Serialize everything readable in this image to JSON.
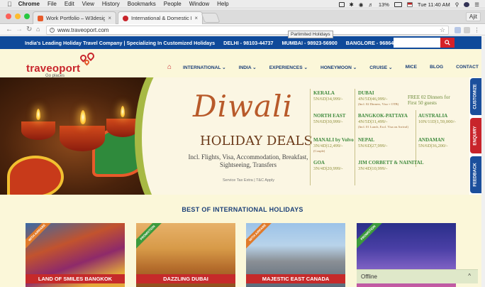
{
  "macos": {
    "app": "Chrome",
    "menus": [
      "File",
      "Edit",
      "View",
      "History",
      "Bookmarks",
      "People",
      "Window",
      "Help"
    ],
    "battery": "13%",
    "clock": "Tue 11:40 AM"
  },
  "browser": {
    "tabs": [
      {
        "title": "Work Portfolio – W3design.in",
        "active": false
      },
      {
        "title": "International & Domestic Holiday",
        "active": true
      }
    ],
    "profile": "Ajit",
    "url": "www.traveoport.com",
    "tooltip": "Parlimited Holidays"
  },
  "topbar": {
    "tagline": "India's Leading Holiday Travel Company | Specializing In Customized Holidays",
    "phones": [
      "DELHI - 98103-44737",
      "MUMBAI - 98923-56900",
      "BANGLORE - 96864-58583"
    ],
    "search_placeholder": ""
  },
  "brand": {
    "logo_text": "traveoport",
    "logo_sub": "Go places",
    "accent": "#c8242b",
    "navy": "#0f4a9a"
  },
  "nav": {
    "items": [
      "INTERNATIONAL ⌄",
      "INDIA ⌄",
      "EXPERIENCES ⌄",
      "HONEYMOON ⌄",
      "CRUISE ⌄",
      "MICE",
      "BLOG",
      "CONTACT"
    ]
  },
  "banner": {
    "headline": "Diwali",
    "subheadline": "HOLIDAY DEALS",
    "includes": "Incl. Flights, Visa, Accommodation, Breakfast, Sightseeing, Transfers",
    "service_tax": "Service Tax Extra | T&C Apply",
    "free_offer": "FREE 02 Dinners for First 50 guests",
    "deals_col1": [
      {
        "place": "KERALA",
        "price": "5N/6D|34,999/-",
        "note": ""
      },
      {
        "place": "NORTH EAST",
        "price": "5N/6D|30,999/-",
        "note": ""
      },
      {
        "place": "MANALI by Volvo",
        "price": "3N/4D|12,499/-",
        "note": "(Couple)"
      },
      {
        "place": "GOA",
        "price": "3N/4D|20,999/-",
        "note": ""
      }
    ],
    "deals_col2": [
      {
        "place": "DUBAI",
        "price": "4N/5D|46,999/-",
        "note": "(Incl. 02 Dinners, Visa + OTB)"
      },
      {
        "place": "BANGKOK-PATTAYA",
        "price": "4N/5D|31,499/-",
        "note": "(Incl. 01 Lunch, Excl. Visa on Arrival)"
      },
      {
        "place": "NEPAL",
        "price": "5N/6D|27,999/-",
        "note": ""
      },
      {
        "place": "JIM CORBETT & NAINITAL",
        "price": "3N/4D|10,999/-",
        "note": ""
      }
    ],
    "deals_col3": [
      {
        "place": "AUSTRALIA",
        "price": "10N/11D|1,59,000/-",
        "note": ""
      },
      {
        "place": "ANDAMAN",
        "price": "5N/6D|36,200/-",
        "note": ""
      }
    ]
  },
  "side_tabs": [
    "CUSTOMIZE",
    "ENQUIRY",
    "FEEDBACK"
  ],
  "section": {
    "title": "BEST OF INTERNATIONAL HOLIDAYS",
    "cards": [
      {
        "label": "LAND OF SMILES BANGKOK",
        "ribbon": "WITH AIRFARE"
      },
      {
        "label": "DAZZLING DUBAI",
        "ribbon": "PROMOTION"
      },
      {
        "label": "MAJESTIC EAST CANADA",
        "ribbon": "WITH AIRFARE"
      },
      {
        "label": "",
        "ribbon": "PROMOTION"
      }
    ]
  },
  "chat": {
    "status": "Offline",
    "caret": "^"
  }
}
